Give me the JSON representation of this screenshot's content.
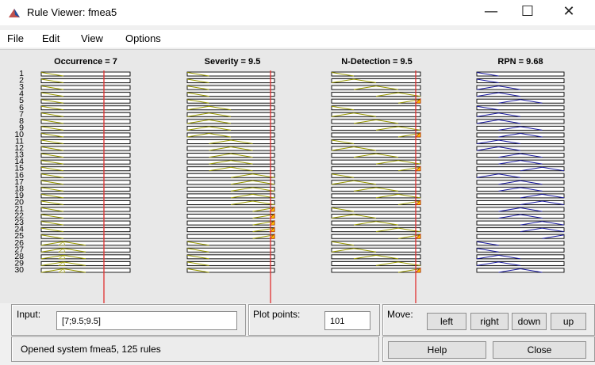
{
  "window": {
    "title": "Rule Viewer: fmea5",
    "minimize_glyph": "—",
    "maximize_glyph": "☐",
    "close_glyph": "✕"
  },
  "menu": [
    "File",
    "Edit",
    "View",
    "Options"
  ],
  "columns": [
    {
      "label": "Occurrence = 7",
      "input_value": 7,
      "mf": "occ",
      "line_color": "#e03030"
    },
    {
      "label": "Severity = 9.5",
      "input_value": 9.5,
      "mf": "sev",
      "line_color": "#e03030"
    },
    {
      "label": "N-Detection = 9.5",
      "input_value": 9.5,
      "mf": "det",
      "line_color": "#e03030"
    },
    {
      "label": "RPN = 9.68",
      "mf": "rpn"
    }
  ],
  "rules": [
    "1",
    "2",
    "3",
    "4",
    "5",
    "6",
    "7",
    "8",
    "9",
    "10",
    "11",
    "12",
    "13",
    "14",
    "15",
    "16",
    "17",
    "18",
    "19",
    "20",
    "21",
    "22",
    "23",
    "24",
    "25",
    "26",
    "27",
    "28",
    "29",
    "30"
  ],
  "colors": {
    "input_mf": "#9a9a00",
    "output_mf": "#1a1aa0",
    "fired_fill": "#ffcc00",
    "fired_stroke": "#c03000"
  },
  "controls": {
    "input_label": "Input:",
    "input_value": "[7;9.5;9.5]",
    "plot_points_label": "Plot points:",
    "plot_points_value": "101",
    "move_label": "Move:",
    "left": "left",
    "right": "right",
    "down": "down",
    "up": "up",
    "status": "Opened system fmea5, 125 rules",
    "help": "Help",
    "close": "Close"
  }
}
